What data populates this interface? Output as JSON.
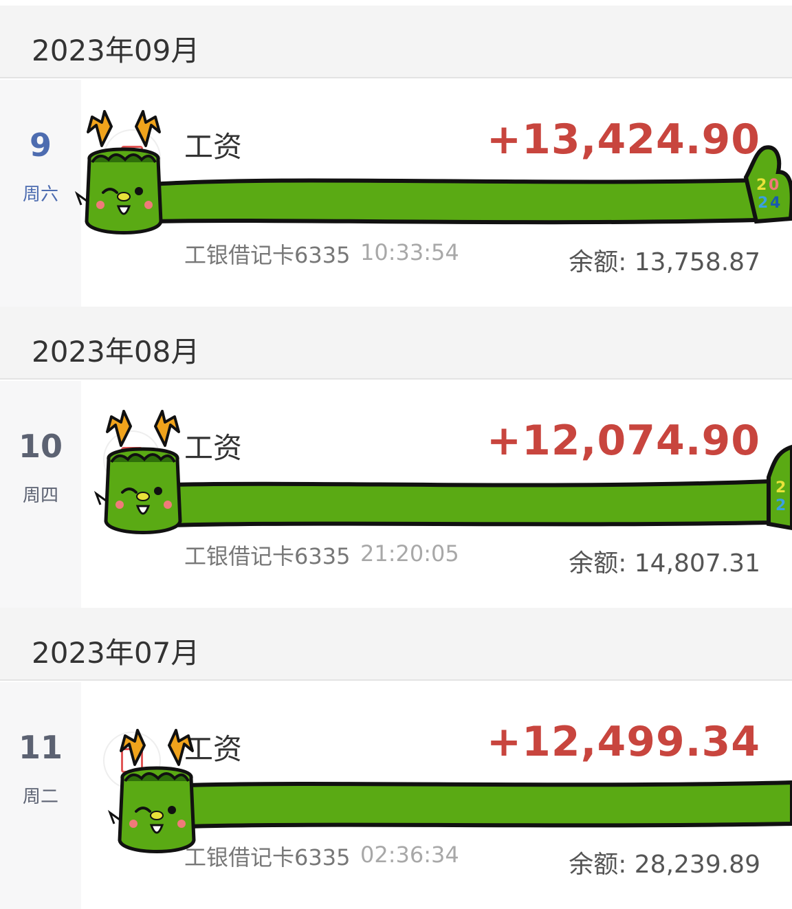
{
  "months": [
    {
      "label": "2023年09月",
      "transaction": {
        "day": "9",
        "weekday": "周六",
        "title": "工资",
        "amount": "+13,424.90",
        "account": "工银借记卡6335",
        "time": "10:33:54",
        "balance": "余额: 13,758.87"
      }
    },
    {
      "label": "2023年08月",
      "transaction": {
        "day": "10",
        "weekday": "周四",
        "title": "工资",
        "amount": "+12,074.90",
        "account": "工银借记卡6335",
        "time": "21:20:05",
        "balance": "余额: 14,807.31"
      }
    },
    {
      "label": "2023年07月",
      "transaction": {
        "day": "11",
        "weekday": "周二",
        "title": "工资",
        "amount": "+12,499.34",
        "account": "工银借记卡6335",
        "time": "02:36:34",
        "balance": "余额: 28,239.89"
      }
    }
  ],
  "sticker": {
    "name": "dragon-sticker",
    "year_text": "2024",
    "body_color": "#5aaa14",
    "antler_color": "#f0a31c",
    "amount_color": "#c8453e"
  }
}
